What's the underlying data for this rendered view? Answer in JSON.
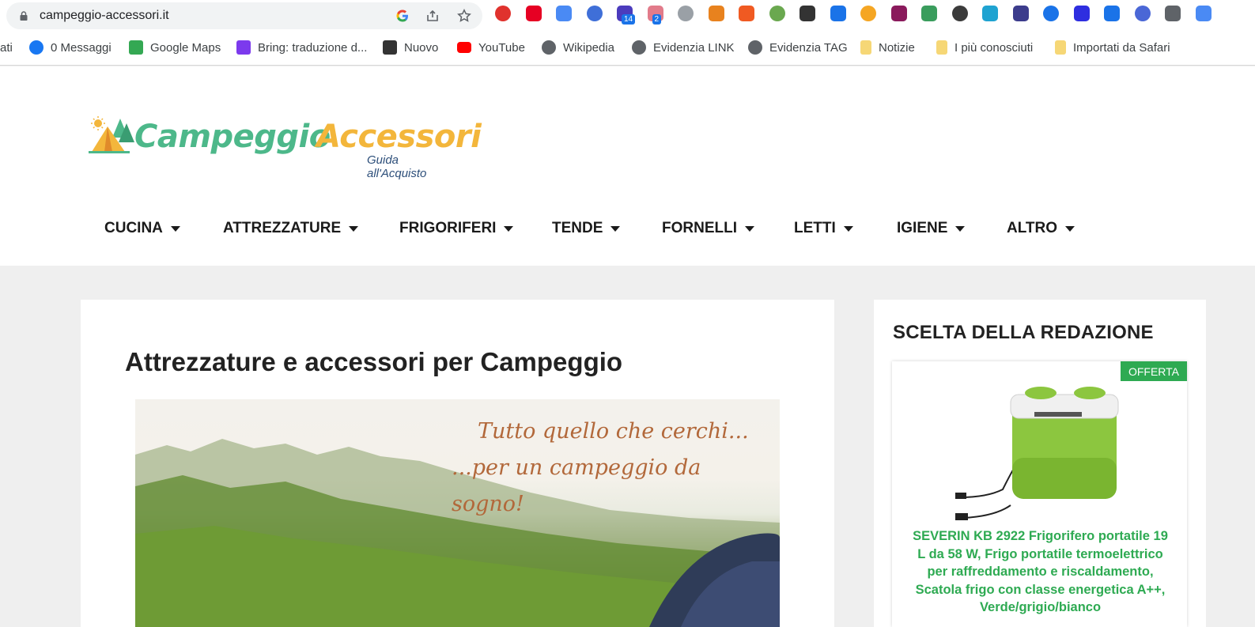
{
  "browser": {
    "url": "campeggio-accessori.it",
    "extensions": [
      {
        "name": "adblock-icon",
        "color": "#e0322d"
      },
      {
        "name": "pinterest-icon",
        "color": "#e60023"
      },
      {
        "name": "translate-icon",
        "color": "#4a8af4"
      },
      {
        "name": "v-extension-icon",
        "color": "#3f6fd8"
      },
      {
        "name": "academic-cap-icon",
        "color": "#4b3bbd",
        "badge": "14"
      },
      {
        "name": "diagram-icon",
        "color": "#e27b8a",
        "badge": "2"
      },
      {
        "name": "cloud-icon",
        "color": "#9aa0a6"
      },
      {
        "name": "robot-icon",
        "color": "#e8821e"
      },
      {
        "name": "seo-icon",
        "color": "#f05a22"
      },
      {
        "name": "eyedropper-icon",
        "color": "#6aa84f"
      },
      {
        "name": "checklist-icon",
        "color": "#333333"
      },
      {
        "name": "check-circle-icon",
        "color": "#1a73e8"
      },
      {
        "name": "egg-icon",
        "color": "#f5a623"
      },
      {
        "name": "chart-icon",
        "color": "#8a1a5c"
      },
      {
        "name": "inbox-check-icon",
        "color": "#3a9d5d"
      },
      {
        "name": "k-icon",
        "color": "#3b3b3b"
      },
      {
        "name": "eye-icon",
        "color": "#1fa3d1"
      },
      {
        "name": "sigma-icon",
        "color": "#3c3c8c"
      },
      {
        "name": "drop-icon",
        "color": "#1a73e8"
      },
      {
        "name": "ij-icon",
        "color": "#2e2ee0"
      },
      {
        "name": "tag-icon",
        "color": "#1a73e8"
      },
      {
        "name": "puzzle-icon",
        "color": "#4a67d6"
      },
      {
        "name": "circle-icon",
        "color": "#5f6368"
      },
      {
        "name": "share-icon",
        "color": "#4a8af4"
      }
    ],
    "bookmarks": [
      {
        "label": "ati",
        "icon": "none"
      },
      {
        "label": "0 Messaggi",
        "icon": "facebook-icon"
      },
      {
        "label": "Google Maps",
        "icon": "maps-pin-icon"
      },
      {
        "label": "Bring: traduzione d...",
        "icon": "dc-icon"
      },
      {
        "label": "Nuovo",
        "icon": "wing-icon"
      },
      {
        "label": "YouTube",
        "icon": "youtube-icon"
      },
      {
        "label": "Wikipedia",
        "icon": "globe-icon"
      },
      {
        "label": "Evidenzia LINK",
        "icon": "globe-icon"
      },
      {
        "label": "Evidenzia TAG",
        "icon": "globe-icon"
      },
      {
        "label": "Notizie",
        "icon": "folder-icon"
      },
      {
        "label": "I più conosciuti",
        "icon": "folder-icon"
      },
      {
        "label": "Importati da Safari",
        "icon": "folder-icon"
      }
    ]
  },
  "site": {
    "logo_part1": "Campeggio",
    "logo_part2": "Accessori",
    "logo_sub": "Guida all'Acquisto",
    "nav": [
      "CUCINA",
      "ATTREZZATURE",
      "FRIGORIFERI",
      "TENDE",
      "FORNELLI",
      "LETTI",
      "IGIENE",
      "ALTRO"
    ]
  },
  "main": {
    "title": "Attrezzature e accessori per Campeggio",
    "hero_line1": "Tutto quello che cerchi...",
    "hero_line2": "...per un campeggio da sogno!"
  },
  "sidebar": {
    "title": "SCELTA DELLA REDAZIONE",
    "badge": "OFFERTA",
    "product_name": "SEVERIN KB 2922 Frigorifero portatile 19 L da 58 W, Frigo portatile termoelettrico per raffreddamento e riscaldamento, Scatola frigo con classe energetica A++, Verde/grigio/bianco"
  }
}
